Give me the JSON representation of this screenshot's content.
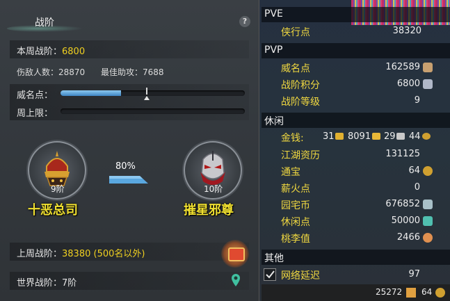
{
  "left": {
    "title": "战阶",
    "help": "?",
    "week_rank_label": "本周战阶：",
    "week_rank_value": "6800",
    "kills_label": "伤敌人数：",
    "kills_value": "28870",
    "best_assist_label": "最佳助攻：",
    "best_assist_value": "7688",
    "fame_label": "威名点：",
    "fame_progress": 0.33,
    "week_cap_label": "周上限：",
    "current_rank": {
      "level": "9阶",
      "name": "十恶总司"
    },
    "next_rank": {
      "level": "10阶",
      "name": "摧星邪尊"
    },
    "advance_percent": "80%",
    "last_week_label": "上周战阶：",
    "last_week_value": "38380 (500名以外)",
    "world_rank_label": "世界战阶：",
    "world_rank_value": "7阶"
  },
  "right": {
    "pve": {
      "header": "PVE",
      "items": [
        {
          "label": "侠行点",
          "value": "38320"
        }
      ]
    },
    "pvp": {
      "header": "PVP",
      "items": [
        {
          "label": "威名点",
          "value": "162589"
        },
        {
          "label": "战阶积分",
          "value": "6800"
        },
        {
          "label": "战阶等级",
          "value": "9"
        }
      ]
    },
    "leisure": {
      "header": "休闲",
      "money_label": "金钱:",
      "money": {
        "a": "31",
        "b": "8091",
        "c": "29",
        "d": "44"
      },
      "items": [
        {
          "label": "江湖资历",
          "value": "131125"
        },
        {
          "label": "通宝",
          "value": "64"
        },
        {
          "label": "薪火点",
          "value": "0"
        },
        {
          "label": "园宅币",
          "value": "676852"
        },
        {
          "label": "休闲点",
          "value": "50000"
        },
        {
          "label": "桃李值",
          "value": "2466"
        }
      ]
    },
    "other": {
      "header": "其他",
      "latency_label": "网络延迟",
      "latency_value": "97"
    },
    "bottom": {
      "left_value": "25272",
      "right_value": "64"
    }
  },
  "colors": {
    "accent_yellow": "#f0d840",
    "progress_blue": "#4a90d0"
  }
}
